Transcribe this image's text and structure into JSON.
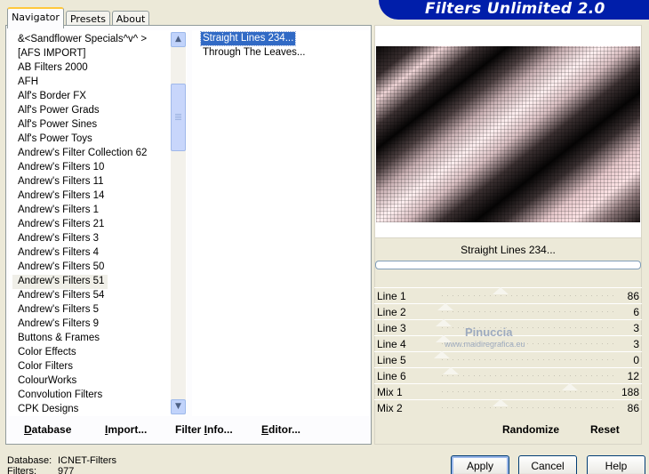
{
  "window": {
    "title": "Filters Unlimited 2.0"
  },
  "tabs": [
    {
      "label": "Navigator",
      "active": true
    },
    {
      "label": "Presets",
      "active": false
    },
    {
      "label": "About",
      "active": false
    }
  ],
  "categories": {
    "items": [
      "&<Sandflower Specials^v^ >",
      "[AFS IMPORT]",
      "AB Filters 2000",
      "AFH",
      "Alf's Border FX",
      "Alf's Power Grads",
      "Alf's Power Sines",
      "Alf's Power Toys",
      "Andrew's Filter Collection 62",
      "Andrew's Filters 10",
      "Andrew's Filters 11",
      "Andrew's Filters 14",
      "Andrew's Filters 1",
      "Andrew's Filters 21",
      "Andrew's Filters 3",
      "Andrew's Filters 4",
      "Andrew's Filters 50",
      "Andrew's Filters 51",
      "Andrew's Filters 54",
      "Andrew's Filters 5",
      "Andrew's Filters 9",
      "Buttons & Frames",
      "Color Effects",
      "Color Filters",
      "ColourWorks",
      "Convolution Filters",
      "CPK Designs"
    ],
    "selected": "Andrew's Filters 51"
  },
  "filters": {
    "items": [
      "Straight Lines 234...",
      "Through The Leaves..."
    ],
    "selected": "Straight Lines 234..."
  },
  "panel_links": {
    "database": {
      "underlined": "D",
      "rest": "atabase"
    },
    "import": {
      "underlined": "I",
      "rest": "mport..."
    },
    "filter_info": {
      "before": "Filter ",
      "underlined": "I",
      "rest": "nfo..."
    },
    "editor": {
      "underlined": "E",
      "rest": "ditor..."
    }
  },
  "preview": {
    "caption": "Straight Lines 234...",
    "progress": 0
  },
  "sliders": [
    {
      "label": "Line 1",
      "value": "86"
    },
    {
      "label": "Line 2",
      "value": "6"
    },
    {
      "label": "Line 3",
      "value": "3"
    },
    {
      "label": "Line 4",
      "value": "3"
    },
    {
      "label": "Line 5",
      "value": "0"
    },
    {
      "label": "Line 6",
      "value": "12"
    },
    {
      "label": "Mix 1",
      "value": "188"
    },
    {
      "label": "Mix 2",
      "value": "86"
    }
  ],
  "slider_levels": [
    0.34,
    0.02,
    0.01,
    0.01,
    0.0,
    0.05,
    0.74,
    0.34
  ],
  "right_links": {
    "randomize": "Randomize",
    "reset": "Reset"
  },
  "watermark": {
    "name": "Pinuccia",
    "url": "www.maidiregrafica.eu"
  },
  "footer": {
    "database_label": "Database:",
    "database_value": "ICNET-Filters",
    "filters_label": "Filters:",
    "filters_value": "977"
  },
  "buttons": {
    "apply": "Apply",
    "cancel": "Cancel",
    "help": "Help"
  },
  "colors": {
    "dialog_bg": "#ECE9D8",
    "banner": "#001EAA",
    "selection": "#316AC5",
    "tab_highlight": "#FFC83C"
  }
}
